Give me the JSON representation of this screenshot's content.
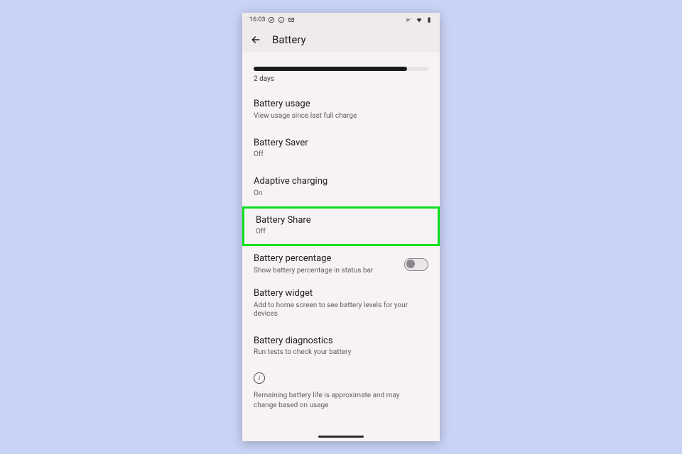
{
  "status": {
    "time": "16:03",
    "icons_left": [
      "check-circle-icon",
      "whatsapp-icon",
      "gmail-icon"
    ],
    "icons_right": [
      "vibrate-icon",
      "wifi-icon",
      "battery-full-icon"
    ]
  },
  "header": {
    "title": "Battery"
  },
  "battery_bar": {
    "fill_percent": 88,
    "label": "2 days"
  },
  "items": {
    "usage": {
      "title": "Battery usage",
      "sub": "View usage since last full charge"
    },
    "saver": {
      "title": "Battery Saver",
      "sub": "Off"
    },
    "adapt": {
      "title": "Adaptive charging",
      "sub": "On"
    },
    "share": {
      "title": "Battery Share",
      "sub": "Off",
      "highlighted": true
    },
    "percent": {
      "title": "Battery percentage",
      "sub": "Show battery percentage in status bar",
      "toggle": false
    },
    "widget": {
      "title": "Battery widget",
      "sub": "Add to home screen to see battery levels for your devices"
    },
    "diag": {
      "title": "Battery diagnostics",
      "sub": "Run tests to check your battery"
    }
  },
  "footer": {
    "text": "Remaining battery life is approximate and may change based on usage"
  }
}
